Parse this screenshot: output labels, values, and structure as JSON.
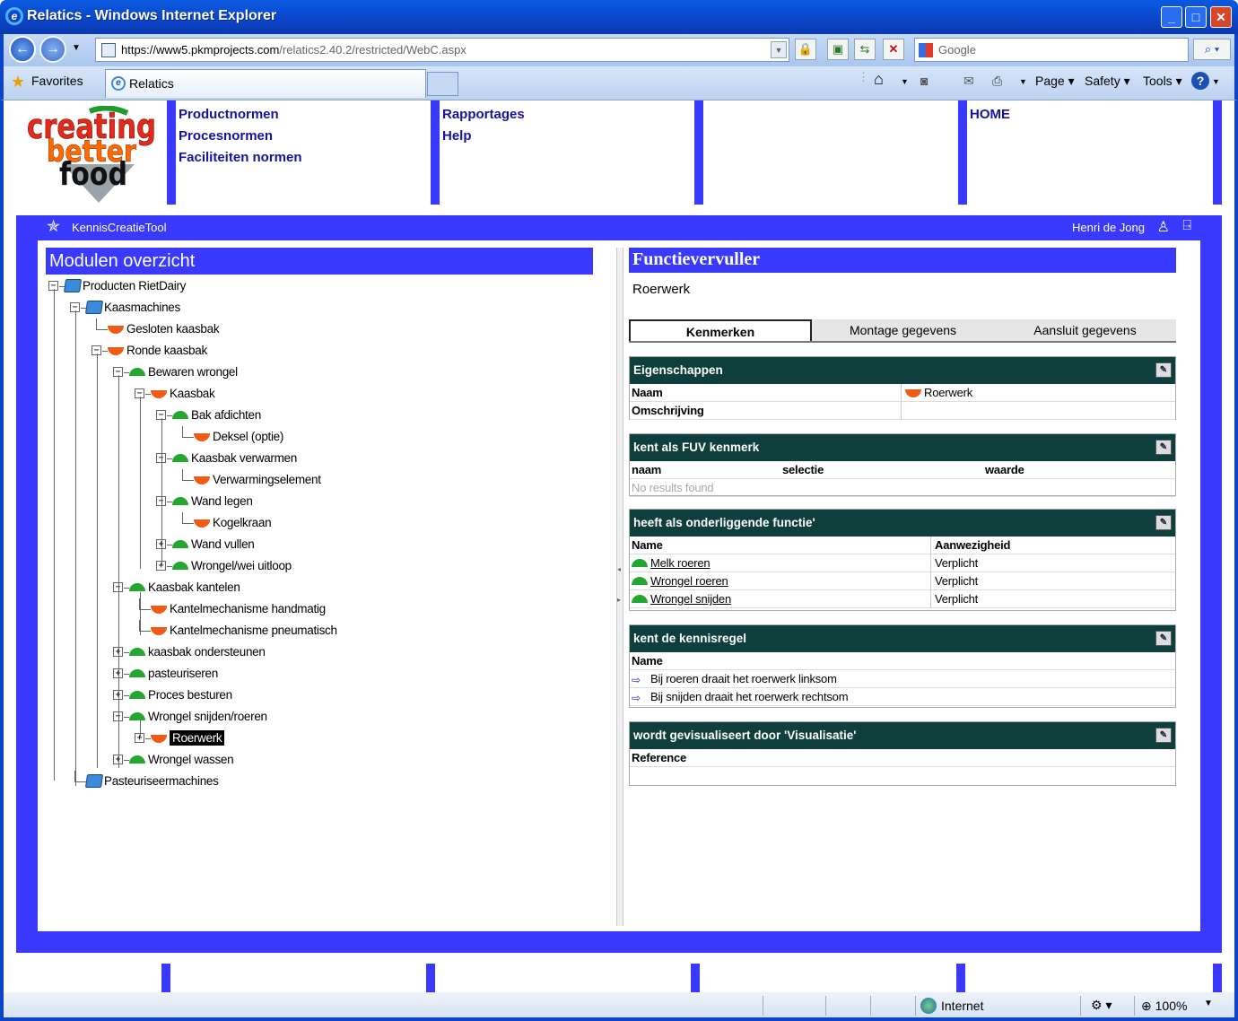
{
  "browser": {
    "title": "Relatics - Windows Internet Explorer",
    "url_prefix": "https://www5.",
    "url_domain": "pkmprojects.com",
    "url_path": "/relatics2.40.2/restricted/WebC.aspx",
    "search_placeholder": "Google",
    "favorites": "Favorites",
    "tab_label": "Relatics",
    "page_menu": "Page",
    "safety_menu": "Safety",
    "tools_menu": "Tools"
  },
  "logo": {
    "line1": "creating",
    "line2": "better",
    "line3": "food"
  },
  "menu": {
    "col1": [
      "Productnormen",
      "Procesnormen",
      "Faciliteiten normen"
    ],
    "col2": [
      "Rapportages",
      "Help"
    ],
    "home": "HOME"
  },
  "subheader": {
    "app": "KennisCreatieTool",
    "user": "Henri de Jong"
  },
  "left": {
    "title": "Modulen overzicht",
    "tree": [
      {
        "label": "Producten RietDairy",
        "icon": "folder",
        "exp": "-"
      },
      {
        "label": "Kaasmachines",
        "icon": "folder",
        "exp": "-"
      },
      {
        "label": "Gesloten kaasbak",
        "icon": "red",
        "exp": ""
      },
      {
        "label": "Ronde kaasbak",
        "icon": "red",
        "exp": "-"
      },
      {
        "label": "Bewaren wrongel",
        "icon": "green",
        "exp": "-"
      },
      {
        "label": "Kaasbak",
        "icon": "red",
        "exp": "-"
      },
      {
        "label": "Bak afdichten",
        "icon": "green",
        "exp": "-"
      },
      {
        "label": "Deksel (optie)",
        "icon": "red",
        "exp": ""
      },
      {
        "label": "Kaasbak verwarmen",
        "icon": "green",
        "exp": "-"
      },
      {
        "label": "Verwarmingselement",
        "icon": "red",
        "exp": ""
      },
      {
        "label": "Wand legen",
        "icon": "green",
        "exp": "-"
      },
      {
        "label": "Kogelkraan",
        "icon": "red",
        "exp": ""
      },
      {
        "label": "Wand vullen",
        "icon": "green",
        "exp": "+"
      },
      {
        "label": "Wrongel/wei uitloop",
        "icon": "green",
        "exp": "+"
      },
      {
        "label": "Kaasbak kantelen",
        "icon": "green",
        "exp": "-"
      },
      {
        "label": "Kantelmechanisme handmatig",
        "icon": "red",
        "exp": ""
      },
      {
        "label": "Kantelmechanisme pneumatisch",
        "icon": "red",
        "exp": ""
      },
      {
        "label": "kaasbak ondersteunen",
        "icon": "green",
        "exp": "+"
      },
      {
        "label": "pasteuriseren",
        "icon": "green",
        "exp": "+"
      },
      {
        "label": "Proces besturen",
        "icon": "green",
        "exp": "+"
      },
      {
        "label": "Wrongel snijden/roeren",
        "icon": "green",
        "exp": "-"
      },
      {
        "label": "Roerwerk",
        "icon": "red",
        "exp": "+"
      },
      {
        "label": "Wrongel wassen",
        "icon": "green",
        "exp": "+"
      },
      {
        "label": "Pasteuriseermachines",
        "icon": "folder",
        "exp": ""
      }
    ]
  },
  "right": {
    "title": "Functievervuller",
    "subtitle": "Roerwerk",
    "tabs": [
      "Kenmerken",
      "Montage gegevens",
      "Aansluit gegevens"
    ],
    "p1": {
      "title": "Eigenschappen",
      "naam_label": "Naam",
      "naam_value": "Roerwerk",
      "omschr_label": "Omschrijving"
    },
    "p2": {
      "title": "kent als FUV kenmerk",
      "cols": [
        "naam",
        "selectie",
        "waarde"
      ],
      "empty": "No results found"
    },
    "p3": {
      "title": "heeft als onderliggende functie'",
      "cols": [
        "Name",
        "Aanwezigheid"
      ],
      "rows": [
        [
          "Melk roeren",
          "Verplicht"
        ],
        [
          "Wrongel roeren",
          "Verplicht"
        ],
        [
          "Wrongel snijden",
          "Verplicht"
        ]
      ]
    },
    "p4": {
      "title": "kent de kennisregel",
      "col": "Name",
      "rows": [
        "Bij roeren draait het roerwerk linksom",
        "Bij snijden draait het roerwerk rechtsom"
      ]
    },
    "p5": {
      "title": "wordt gevisualiseert door 'Visualisatie'",
      "col": "Reference"
    }
  },
  "status": {
    "zone": "Internet",
    "zoom": "100%"
  }
}
